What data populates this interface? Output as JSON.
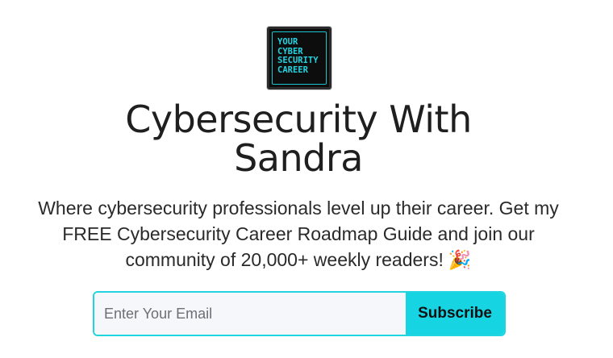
{
  "logo": {
    "lines": [
      "YOUR",
      "CYBER",
      "SECURITY",
      "CAREER"
    ],
    "text_color": "#22d3e0",
    "background": "#0d0d0d"
  },
  "hero": {
    "title": "Cybersecurity With Sandra",
    "description": "Where cybersecurity professionals level up their career. Get my FREE Cybersecurity Career Roadmap Guide and join our community of 20,000+ weekly readers!",
    "emoji_icon": "party-popper-icon",
    "emoji_glyph": "🎉"
  },
  "signup": {
    "email_placeholder": "Enter Your Email",
    "email_value": "",
    "subscribe_label": "Subscribe",
    "accent_color": "#17d4e2"
  }
}
